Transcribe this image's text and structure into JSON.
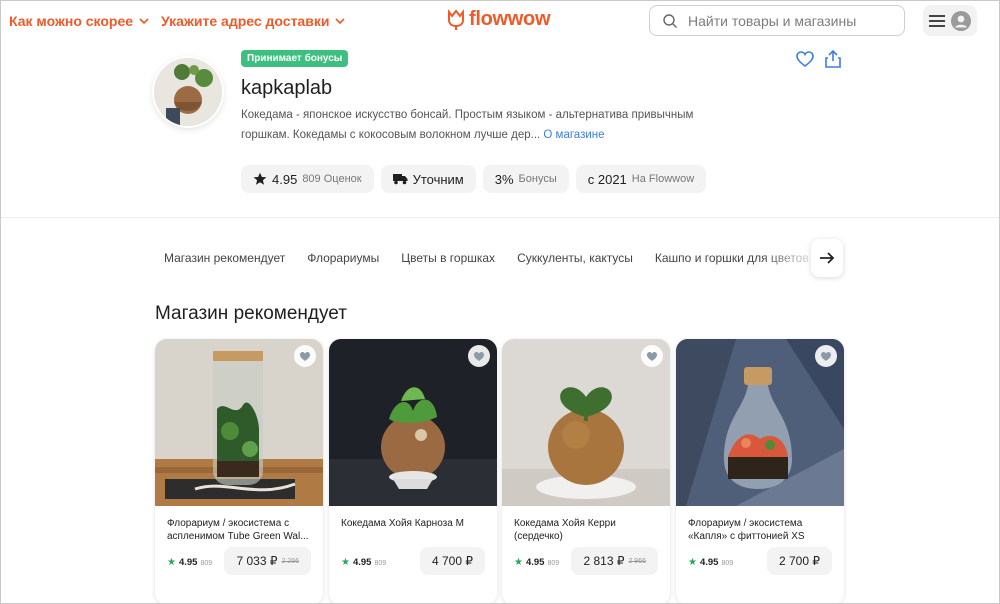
{
  "header": {
    "delivery_time_label": "Как можно скорее",
    "address_label": "Укажите адрес доставки",
    "logo_text": "flowwow",
    "search_placeholder": "Найти товары и магазины",
    "accent_color": "#f05a28"
  },
  "shop": {
    "bonus_badge": "Принимает бонусы",
    "name": "kapkaplab",
    "description": "Кокедама - японское искусство бонсай. Простым языком - альтернатива привычным горшкам. Кокедамы с кокосовым волокном лучше дер...",
    "more_link": "О магазине",
    "stats": {
      "rating": "4.95",
      "rating_count": "809 Оценок",
      "delivery": "Уточним",
      "bonus_percent": "3%",
      "bonus_label": "Бонусы",
      "since": "с 2021",
      "since_label": "На Flowwow"
    }
  },
  "categories": [
    "Магазин рекомендует",
    "Флорариумы",
    "Цветы в горшках",
    "Суккуленты, кактусы",
    "Кашпо и горшки для цветов"
  ],
  "section_title": "Магазин рекомендует",
  "products": [
    {
      "title": "Флорариум / экосистема с аспленимом Tube Green Wal...",
      "rating": "4.95",
      "reviews": "809",
      "price": "7 033 ₽",
      "old_price": "2 266"
    },
    {
      "title": "Кокедама Хойя Карноза M",
      "rating": "4.95",
      "reviews": "809",
      "price": "4 700 ₽",
      "old_price": ""
    },
    {
      "title": "Кокедама Хойя Керри (сердечко)",
      "rating": "4.95",
      "reviews": "809",
      "price": "2 813 ₽",
      "old_price": "2 966"
    },
    {
      "title": "Флорариум / экосистема «Капля» с фиттонией XS",
      "rating": "4.95",
      "reviews": "809",
      "price": "2 700 ₽",
      "old_price": ""
    }
  ]
}
